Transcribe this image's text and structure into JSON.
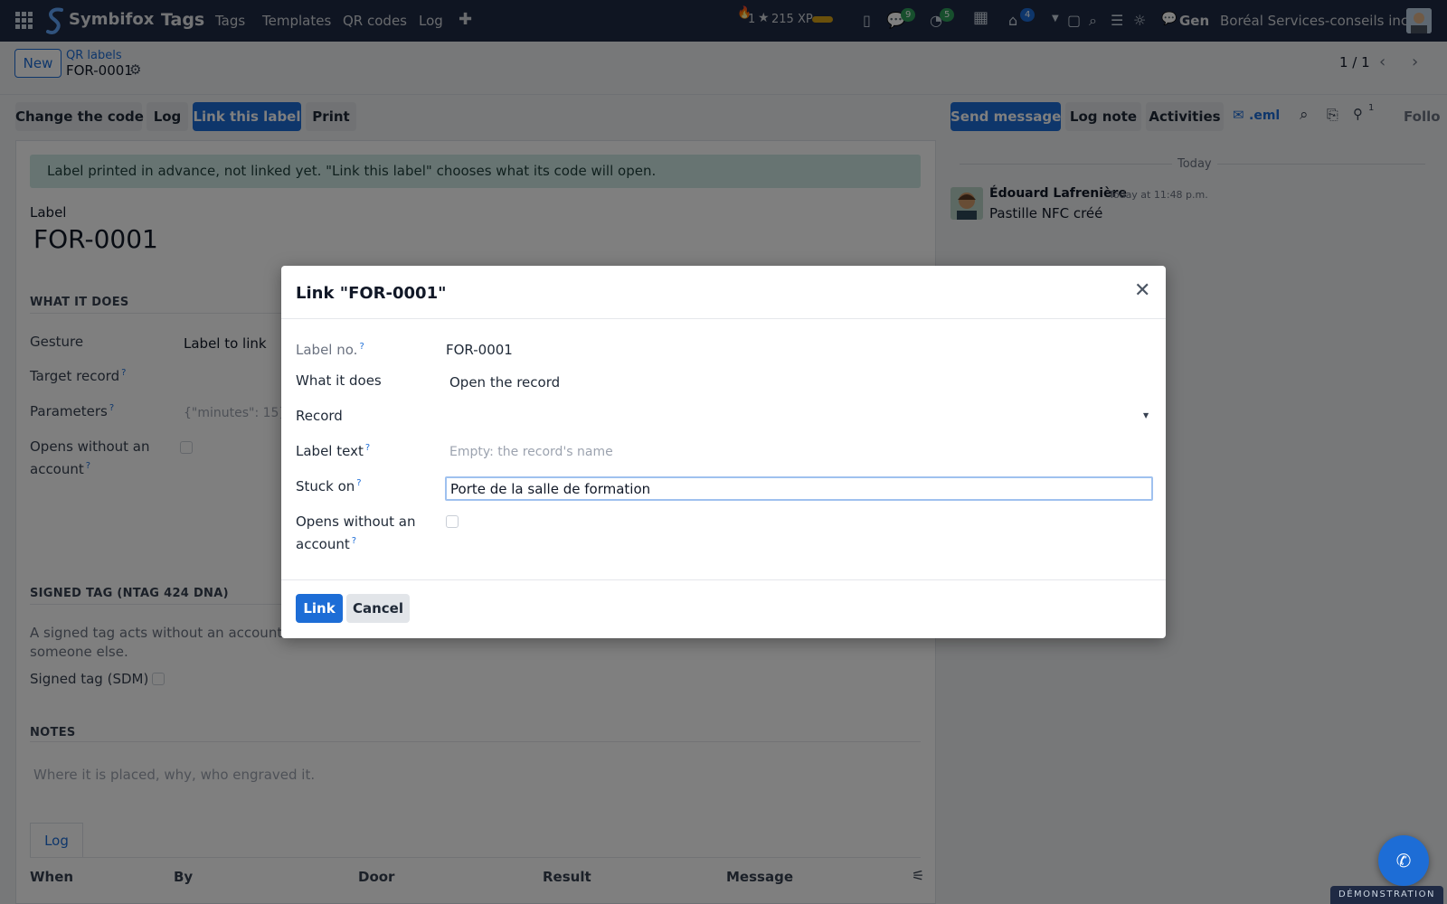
{
  "navbar": {
    "brand": "Symbifox",
    "app_name": "Tags",
    "menu": [
      "Tags",
      "Templates",
      "QR codes",
      "Log"
    ],
    "streak": "1",
    "xp": "215 XP",
    "messages_count": "9",
    "activities_count": "5",
    "tray_count": "4",
    "chat_label": "Gen",
    "company": "Boréal Services-conseils inc."
  },
  "control": {
    "new_label": "New",
    "breadcrumb_parent": "QR labels",
    "record_name": "FOR-0001",
    "pager": "1 / 1"
  },
  "status_buttons": {
    "change_code": "Change the code",
    "log": "Log",
    "link_label": "Link this label",
    "print": "Print"
  },
  "chatter": {
    "send_message": "Send message",
    "log_note": "Log note",
    "activities": "Activities",
    "eml": ".eml",
    "followers_count": "1",
    "follow": "Follo",
    "day": "Today",
    "author": "Édouard Lafrenière",
    "time": "Today at 11:48 p.m.",
    "body": "Pastille NFC créé"
  },
  "form": {
    "alert": "Label printed in advance, not linked yet. \"Link this label\" chooses what its code will open.",
    "label_caption": "Label",
    "label_value": "FOR-0001",
    "section_what": "WHAT IT DOES",
    "gesture_label": "Gesture",
    "gesture_value": "Label to link",
    "target_label": "Target record",
    "params_label": "Parameters",
    "params_placeholder": "{\"minutes\": 15}",
    "opens_label_1": "Opens without an",
    "opens_label_2": "account",
    "section_signed": "SIGNED TAG (NTAG 424 DNA)",
    "signed_text_1": "A signed tag acts without an account: the",
    "signed_text_2": "someone else.",
    "signed_label": "Signed tag (SDM)",
    "section_notes": "NOTES",
    "notes_placeholder": "Where it is placed, why, who engraved it.",
    "log_tab": "Log",
    "columns": [
      "When",
      "By",
      "Door",
      "Result",
      "Message"
    ]
  },
  "dialog": {
    "title": "Link \"FOR-0001\"",
    "label_no_label": "Label no.",
    "label_no_value": "FOR-0001",
    "what_label": "What it does",
    "what_value": "Open the record",
    "record_label": "Record",
    "label_text_label": "Label text",
    "label_text_placeholder": "Empty: the record's name",
    "stuck_label": "Stuck on",
    "stuck_value": "Porte de la salle de formation",
    "opens_label_1": "Opens without an",
    "opens_label_2": "account",
    "link_button": "Link",
    "cancel_button": "Cancel"
  },
  "footer": {
    "demo_ribbon": "DÉMONSTRATION"
  },
  "colors": {
    "navbar": "#1f2a44",
    "primary": "#1d6dd6",
    "alert_bg": "#cfe8e5",
    "badge_green": "#2e9e5b"
  }
}
